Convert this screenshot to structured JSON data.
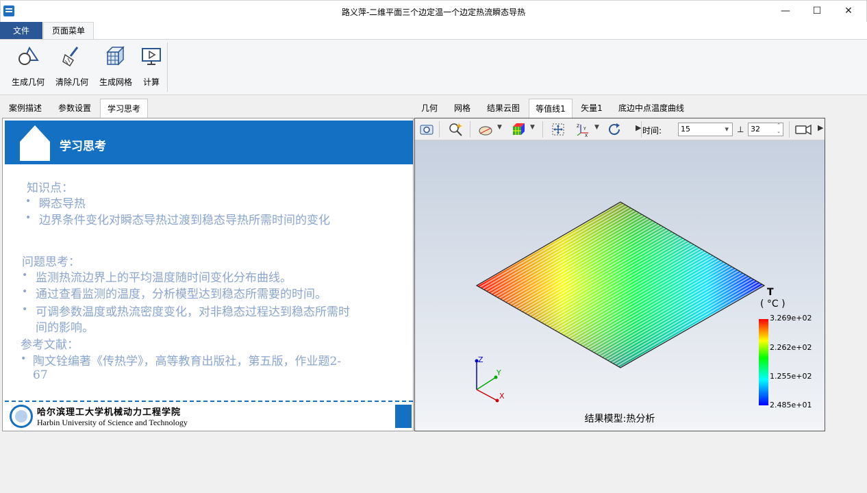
{
  "window": {
    "title": "路义萍-二维平面三个边定温一个边定热流瞬态导热",
    "min": "—",
    "max": "☐",
    "close": "✕"
  },
  "ribbon": {
    "file_tab": "文件",
    "page_tab": "页面菜单",
    "buttons": [
      {
        "label": "生成几何",
        "icon": "geometry-icon"
      },
      {
        "label": "清除几何",
        "icon": "broom-icon"
      },
      {
        "label": "生成网格",
        "icon": "mesh-cube-icon"
      },
      {
        "label": "计算",
        "icon": "play-monitor-icon"
      }
    ]
  },
  "left_tabs": [
    "案例描述",
    "参数设置",
    "学习思考"
  ],
  "right_tabs": [
    "几何",
    "网格",
    "结果云图",
    "等值线1",
    "矢量1",
    "底边中点温度曲线"
  ],
  "study": {
    "title": "学习思考",
    "knowledge_heading": "知识点：",
    "knowledge": [
      "瞬态导热",
      "边界条件变化对瞬态导热过渡到稳态导热所需时间的变化"
    ],
    "question_heading": "问题思考：",
    "questions": [
      "监测热流边界上的平均温度随时间变化分布曲线。",
      "通过查看监测的温度，分析模型达到稳态所需要的时间。",
      "可调参数温度或热流密度变化，对非稳态过程达到稳态所需时",
      "间的影响。"
    ],
    "ref_heading": "参考文献：",
    "refs": [
      "陶文铨编著《传热学》，高等教育出版社，第五版，作业题2-",
      "67"
    ],
    "school_cn": "哈尔滨理工大学机械动力工程学院",
    "school_en": "Harbin University of Science and Technology"
  },
  "toolbar": {
    "time_label": "时间:",
    "time_value": "15",
    "step_value": "32"
  },
  "viewer": {
    "legend_title": "T",
    "legend_unit": "( °C )",
    "legend_ticks": [
      "3.269e+02",
      "2.262e+02",
      "1.255e+02",
      "2.485e+01"
    ],
    "model_label": "结果模型:热分析",
    "axes": [
      "Z",
      "Y",
      "X"
    ]
  },
  "colors": {
    "accent": "#1470c2",
    "file_tab": "#2b5797",
    "text_blue": "#8aa6cf"
  }
}
